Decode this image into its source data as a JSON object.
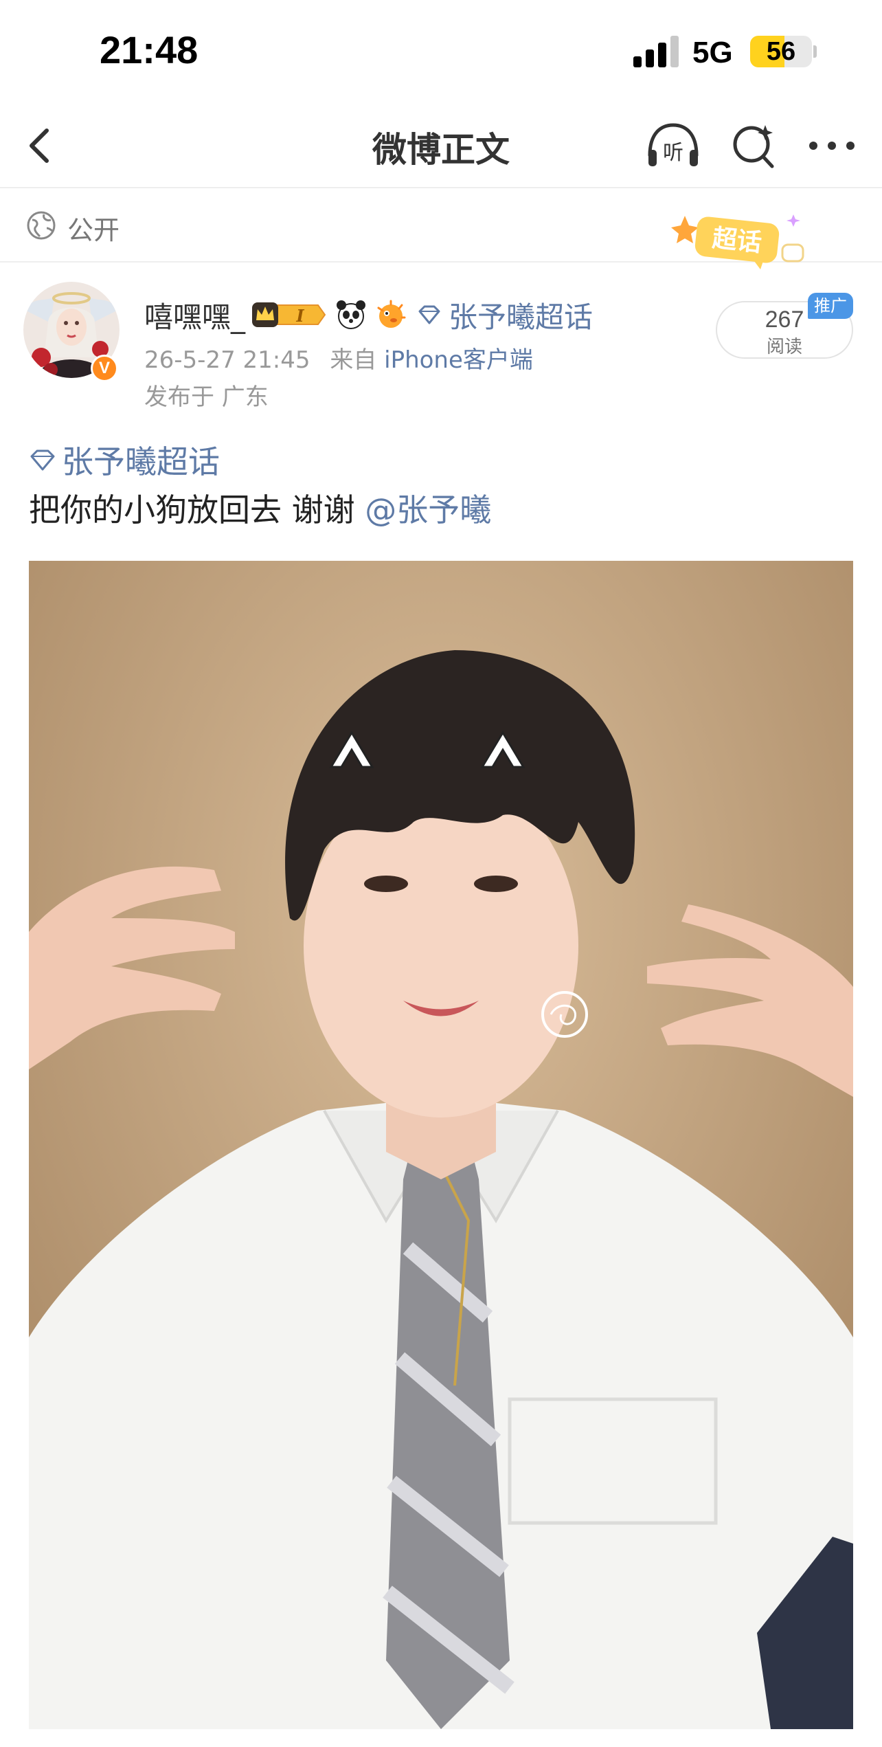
{
  "status_bar": {
    "time": "21:48",
    "network": "5G",
    "battery": "56",
    "battery_level": 0.56
  },
  "nav": {
    "title": "微博正文",
    "back_icon": "chevron-left-icon",
    "listen_icon": "headphones-listen-icon",
    "listen_glyph": "听",
    "search_icon": "search-sparkle-icon",
    "more_icon": "more-dots-icon"
  },
  "visibility": {
    "label": "公开",
    "icon": "globe-icon",
    "supertopic_badge": "超话"
  },
  "author": {
    "username": "嘻嘿嘿_",
    "level_badge": "I",
    "verified_mark": "V",
    "topic": "张予曦超话",
    "meta_time": "26-5-27 21:45",
    "meta_from": "来自",
    "meta_client": "iPhone客户端",
    "location": "发布于 广东"
  },
  "stats": {
    "read_count": "267",
    "read_label": "阅读",
    "promo_tag": "推广"
  },
  "post": {
    "topic": "张予曦超话",
    "text": "把你的小狗放回去 谢谢",
    "mention": "@张予曦"
  },
  "colors": {
    "link_blue": "#5e7aa6",
    "promo_blue": "#4b96e6",
    "battery_yellow": "#ffd21e",
    "verified_orange": "#ff8a1d"
  }
}
